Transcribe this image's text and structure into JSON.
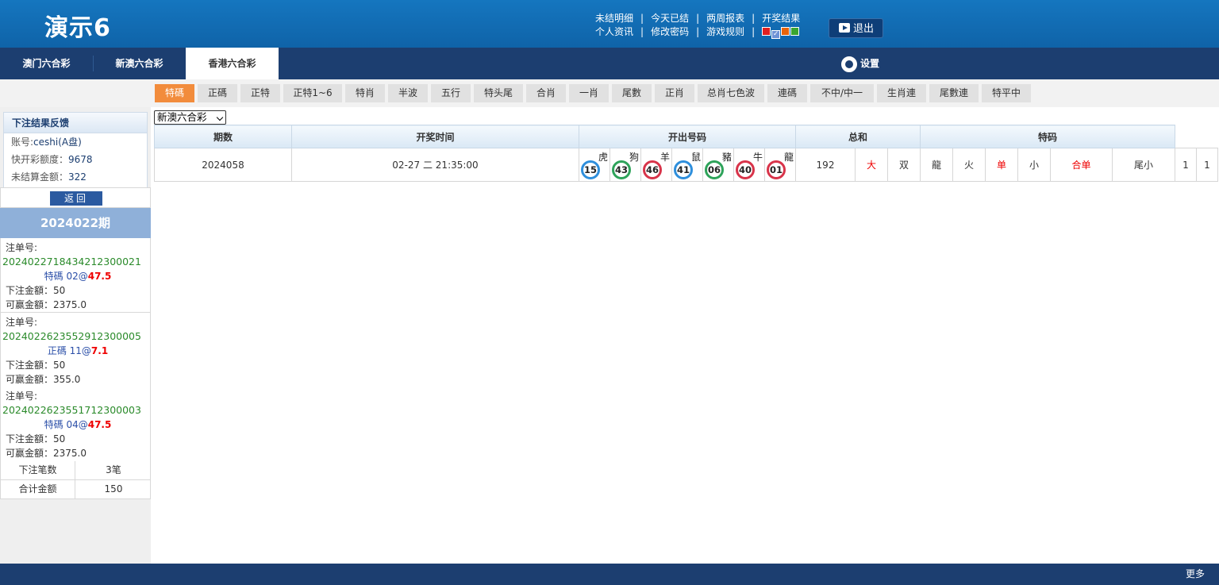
{
  "app": {
    "logo": "演示6"
  },
  "toplinks": {
    "row1": [
      "未结明细",
      "今天已结",
      "两周报表",
      "开奖结果"
    ],
    "row2": [
      "个人资讯",
      "修改密码",
      "游戏规则"
    ],
    "sep": "|",
    "swatches": [
      "#e02020",
      "#6e93d6",
      "#e8640a",
      "#3aa531"
    ],
    "check_mark": "✓",
    "logout": "退出"
  },
  "nav": {
    "tabs": [
      "澳门六合彩",
      "新澳六合彩",
      "香港六合彩"
    ],
    "active": 2,
    "settings": "设置"
  },
  "subtabs": {
    "items": [
      "特碼",
      "正碼",
      "正特",
      "正特1~6",
      "特肖",
      "半波",
      "五行",
      "特头尾",
      "合肖",
      "一肖",
      "尾數",
      "正肖",
      "总肖七色波",
      "連碼",
      "不中/中一",
      "生肖連",
      "尾數連",
      "特平中"
    ],
    "active": 0
  },
  "sidebar": {
    "feedback_title": "下注结果反馈",
    "account_label": "账号:",
    "account_value": "ceshi(A盘)",
    "quota_label": "快开彩额度：",
    "quota_value": "9678",
    "unsettled_label": "未结算金额：",
    "unsettled_value": "322",
    "back": "返回",
    "period": "2024022期",
    "bets": [
      {
        "no_label": "注单号:",
        "no": "2024022718434212300021",
        "item": "特碼 02",
        "at": "@",
        "odds": "47.5",
        "amount_label": "下注金額：",
        "amount": "50",
        "win_label": "可赢金額：",
        "win": "2375.0"
      },
      {
        "no_label": "注单号:",
        "no": "2024022623552912300005",
        "item": "正碼 11",
        "at": "@",
        "odds": "7.1",
        "amount_label": "下注金額：",
        "amount": "50",
        "win_label": "可赢金額：",
        "win": "355.0"
      },
      {
        "no_label": "注单号:",
        "no": "2024022623551712300003",
        "item": "特碼 04",
        "at": "@",
        "odds": "47.5",
        "amount_label": "下注金額：",
        "amount": "50",
        "win_label": "可赢金額：",
        "win": "2375.0"
      }
    ],
    "count_label": "下注笔数",
    "count_value": "3笔",
    "total_label": "合计金额",
    "total_value": "150"
  },
  "main": {
    "select_value": "新澳六合彩",
    "headers": [
      "期数",
      "开奖时间",
      "开出号码",
      "总和",
      "特码"
    ],
    "row": {
      "period": "2024058",
      "time": "02-27 二 21:35:00",
      "balls": [
        {
          "num": "15",
          "zodiac": "虎",
          "color": "blue"
        },
        {
          "num": "43",
          "zodiac": "狗",
          "color": "green"
        },
        {
          "num": "46",
          "zodiac": "羊",
          "color": "red"
        },
        {
          "num": "41",
          "zodiac": "鼠",
          "color": "blue"
        },
        {
          "num": "06",
          "zodiac": "豬",
          "color": "green"
        },
        {
          "num": "40",
          "zodiac": "牛",
          "color": "red"
        },
        {
          "num": "01",
          "zodiac": "龍",
          "color": "red"
        }
      ],
      "sum": "192",
      "sum_size": "大",
      "sum_parity": "双",
      "sp_zodiac": "龍",
      "sp_element": "火",
      "sp_parity": "单",
      "sp_size": "小",
      "sp_combined": "合单",
      "sp_tail": "尾小",
      "extra1": "1",
      "extra2": "1"
    }
  },
  "footer": {
    "more": "更多"
  }
}
